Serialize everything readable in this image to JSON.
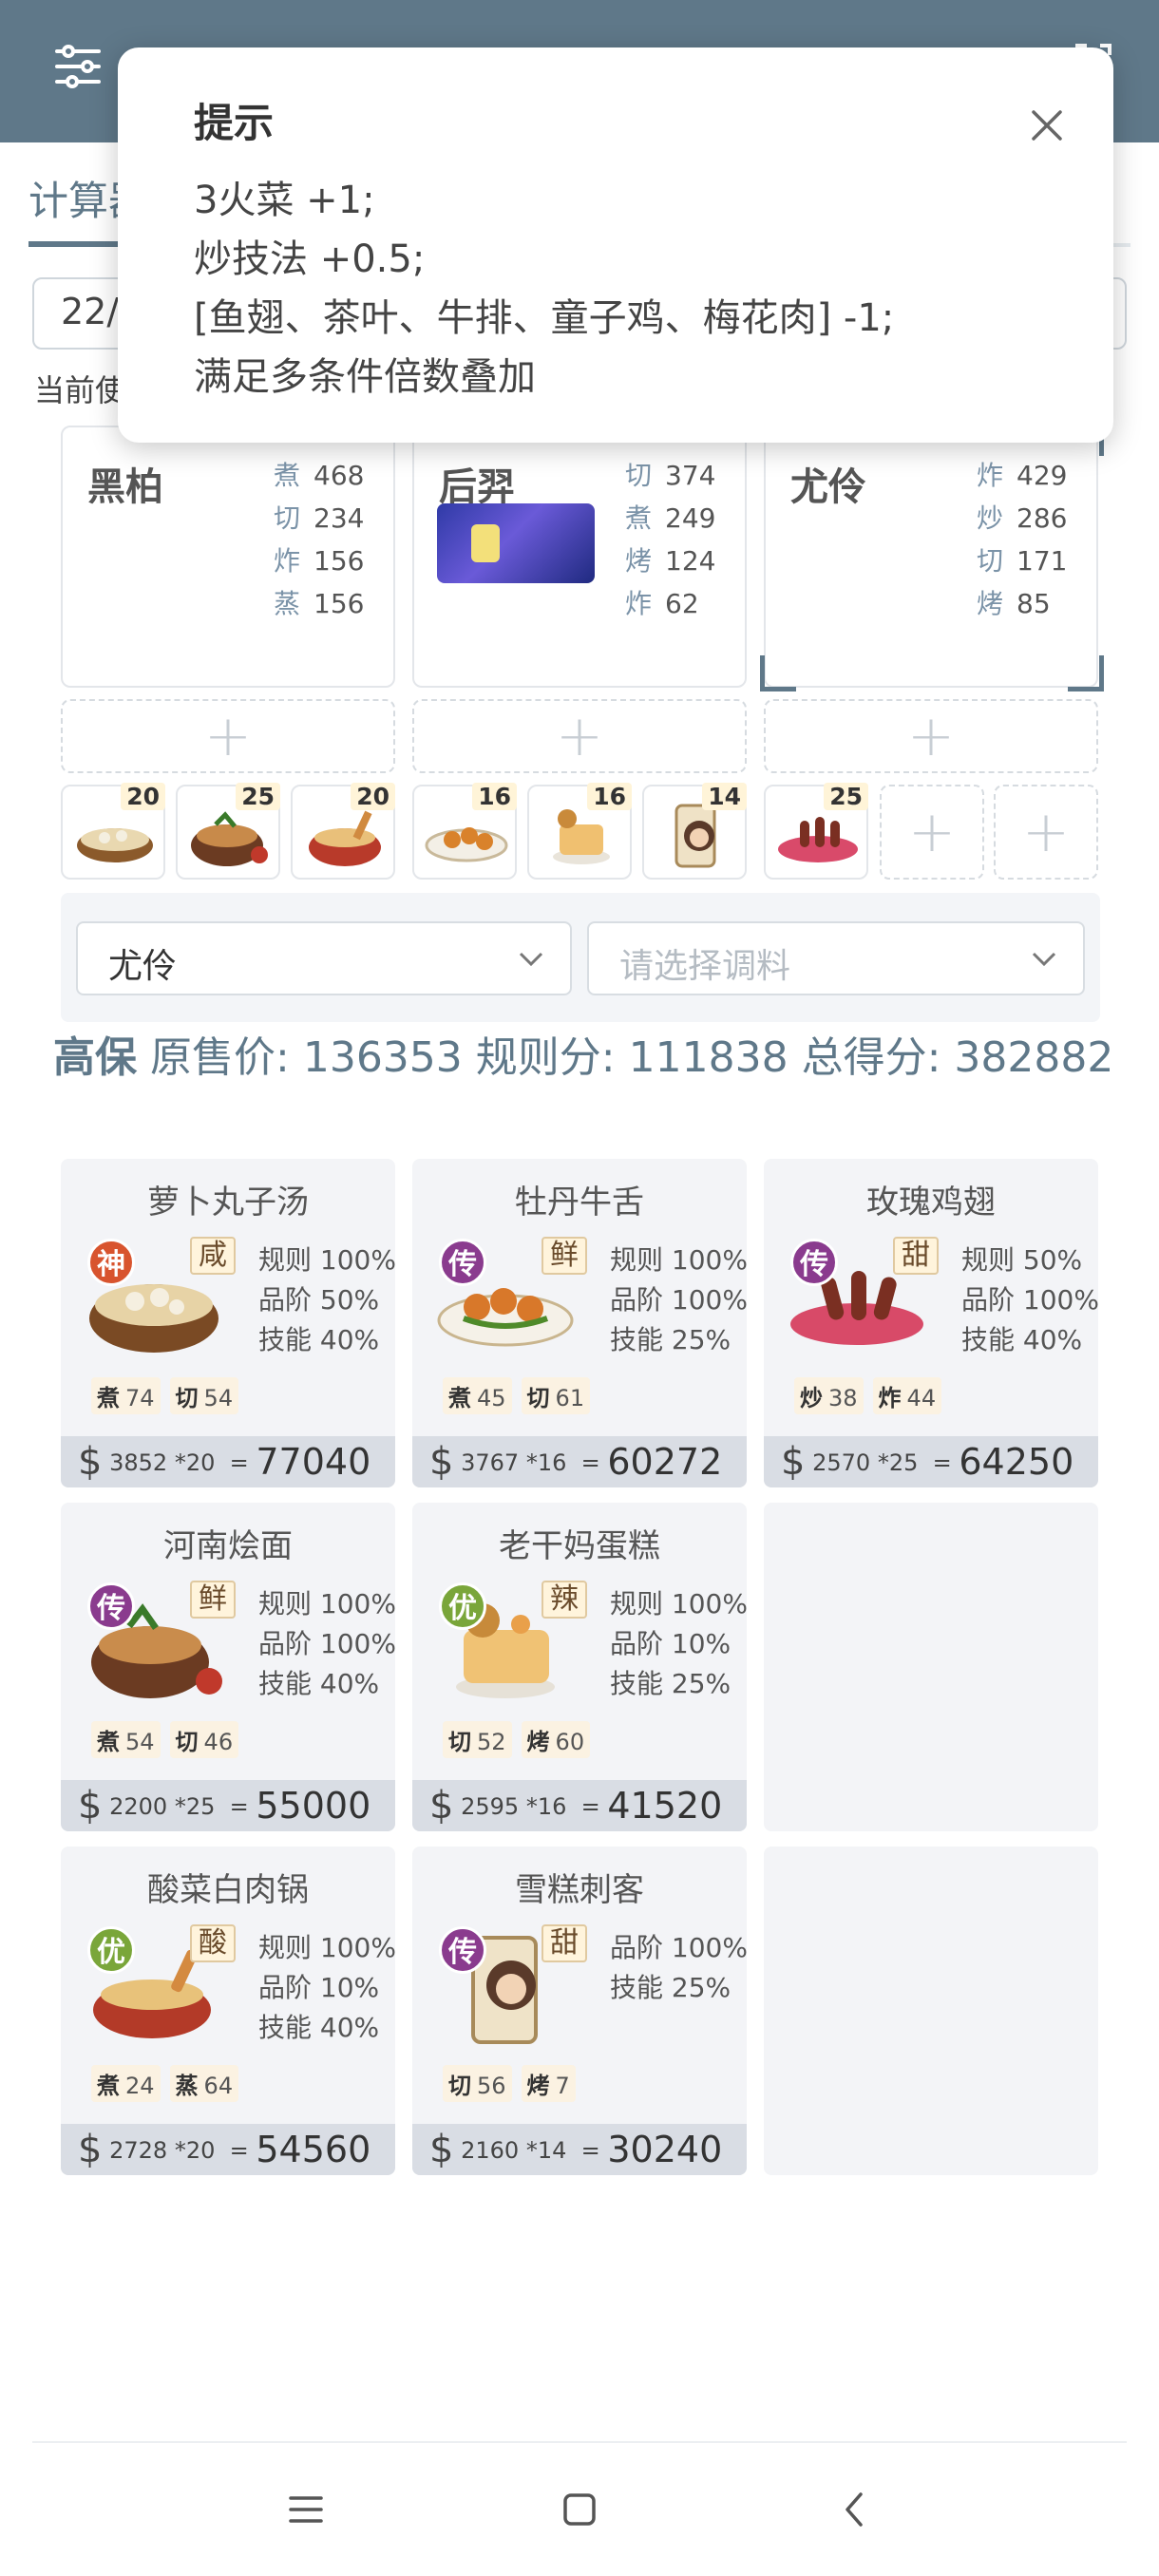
{
  "header": {
    "filter_icon": "sliders-icon",
    "corner_icon": "expand-icon"
  },
  "tab": {
    "label": "计算器"
  },
  "date": {
    "value": "22/"
  },
  "current_label": "当前使",
  "chefs": [
    {
      "name": "黑柏",
      "stats": [
        [
          "煮",
          "468"
        ],
        [
          "切",
          "234"
        ],
        [
          "炸",
          "156"
        ],
        [
          "蒸",
          "156"
        ]
      ]
    },
    {
      "name": "后羿",
      "stats": [
        [
          "切",
          "374"
        ],
        [
          "煮",
          "249"
        ],
        [
          "烤",
          "124"
        ],
        [
          "炸",
          "62"
        ]
      ]
    },
    {
      "name": "尤伶",
      "stats": [
        [
          "炸",
          "429"
        ],
        [
          "炒",
          "286"
        ],
        [
          "切",
          "171"
        ],
        [
          "烤",
          "85"
        ]
      ]
    }
  ],
  "plus_symbol": "+",
  "dish_thumbs": [
    {
      "count": "20",
      "name": "萝卜丸子汤"
    },
    {
      "count": "25",
      "name": "河南烩面"
    },
    {
      "count": "20",
      "name": "酸菜白肉锅"
    },
    {
      "count": "16",
      "name": "牡丹牛舌"
    },
    {
      "count": "16",
      "name": "老干妈蛋糕"
    },
    {
      "count": "14",
      "name": "雪糕刺客"
    },
    {
      "count": "25",
      "name": "玫瑰鸡翅"
    }
  ],
  "selectors": {
    "chef_value": "尤伶",
    "seasoning_placeholder": "请选择调料"
  },
  "summary": {
    "name": "高保",
    "orig_label": "原售价:",
    "orig_value": "136353",
    "rule_label": "规则分:",
    "rule_value": "111838",
    "total_label": "总得分:",
    "total_value": "382882"
  },
  "results": [
    {
      "title": "萝卜丸子汤",
      "rarity": "神",
      "rarity_color": "#d8542e",
      "taste": "咸",
      "pcts": [
        "规则 100%",
        "品阶 50%",
        "技能 40%"
      ],
      "skills": [
        [
          "煮",
          "74"
        ],
        [
          "切",
          "54"
        ]
      ],
      "price": "3852",
      "mult": "*20",
      "eq": "=",
      "total": "77040"
    },
    {
      "title": "牡丹牛舌",
      "rarity": "传",
      "rarity_color": "#8a3b8e",
      "taste": "鲜",
      "pcts": [
        "规则 100%",
        "品阶 100%",
        "技能 25%"
      ],
      "skills": [
        [
          "煮",
          "45"
        ],
        [
          "切",
          "61"
        ]
      ],
      "price": "3767",
      "mult": "*16",
      "eq": "=",
      "total": "60272"
    },
    {
      "title": "玫瑰鸡翅",
      "rarity": "传",
      "rarity_color": "#8a3b8e",
      "taste": "甜",
      "pcts": [
        "规则 50%",
        "品阶 100%",
        "技能 40%"
      ],
      "skills": [
        [
          "炒",
          "38"
        ],
        [
          "炸",
          "44"
        ]
      ],
      "price": "2570",
      "mult": "*25",
      "eq": "=",
      "total": "64250"
    },
    {
      "title": "河南烩面",
      "rarity": "传",
      "rarity_color": "#8a3b8e",
      "taste": "鲜",
      "pcts": [
        "规则 100%",
        "品阶 100%",
        "技能 40%"
      ],
      "skills": [
        [
          "煮",
          "54"
        ],
        [
          "切",
          "46"
        ]
      ],
      "price": "2200",
      "mult": "*25",
      "eq": "=",
      "total": "55000"
    },
    {
      "title": "老干妈蛋糕",
      "rarity": "优",
      "rarity_color": "#7aa63a",
      "taste": "辣",
      "pcts": [
        "规则 100%",
        "品阶 10%",
        "技能 25%"
      ],
      "skills": [
        [
          "切",
          "52"
        ],
        [
          "烤",
          "60"
        ]
      ],
      "price": "2595",
      "mult": "*16",
      "eq": "=",
      "total": "41520"
    },
    {
      "title": "酸菜白肉锅",
      "rarity": "优",
      "rarity_color": "#7aa63a",
      "taste": "酸",
      "pcts": [
        "规则 100%",
        "品阶 10%",
        "技能 40%"
      ],
      "skills": [
        [
          "煮",
          "24"
        ],
        [
          "蒸",
          "64"
        ]
      ],
      "price": "2728",
      "mult": "*20",
      "eq": "=",
      "total": "54560"
    },
    {
      "title": "雪糕刺客",
      "rarity": "传",
      "rarity_color": "#8a3b8e",
      "taste": "甜",
      "pcts": [
        "品阶 100%",
        "技能 25%"
      ],
      "skills": [
        [
          "切",
          "56"
        ],
        [
          "烤",
          "7"
        ]
      ],
      "price": "2160",
      "mult": "*14",
      "eq": "=",
      "total": "30240"
    }
  ],
  "dollar": "$",
  "popup": {
    "title": "提示",
    "lines": [
      "3火菜 +1;",
      "炒技法 +0.5;",
      "[鱼翅、茶叶、牛排、童子鸡、梅花肉] -1;",
      "满足多条件倍数叠加"
    ]
  },
  "nav": {
    "menu_icon": "menu-icon",
    "home_icon": "home-icon",
    "back_icon": "back-icon"
  }
}
